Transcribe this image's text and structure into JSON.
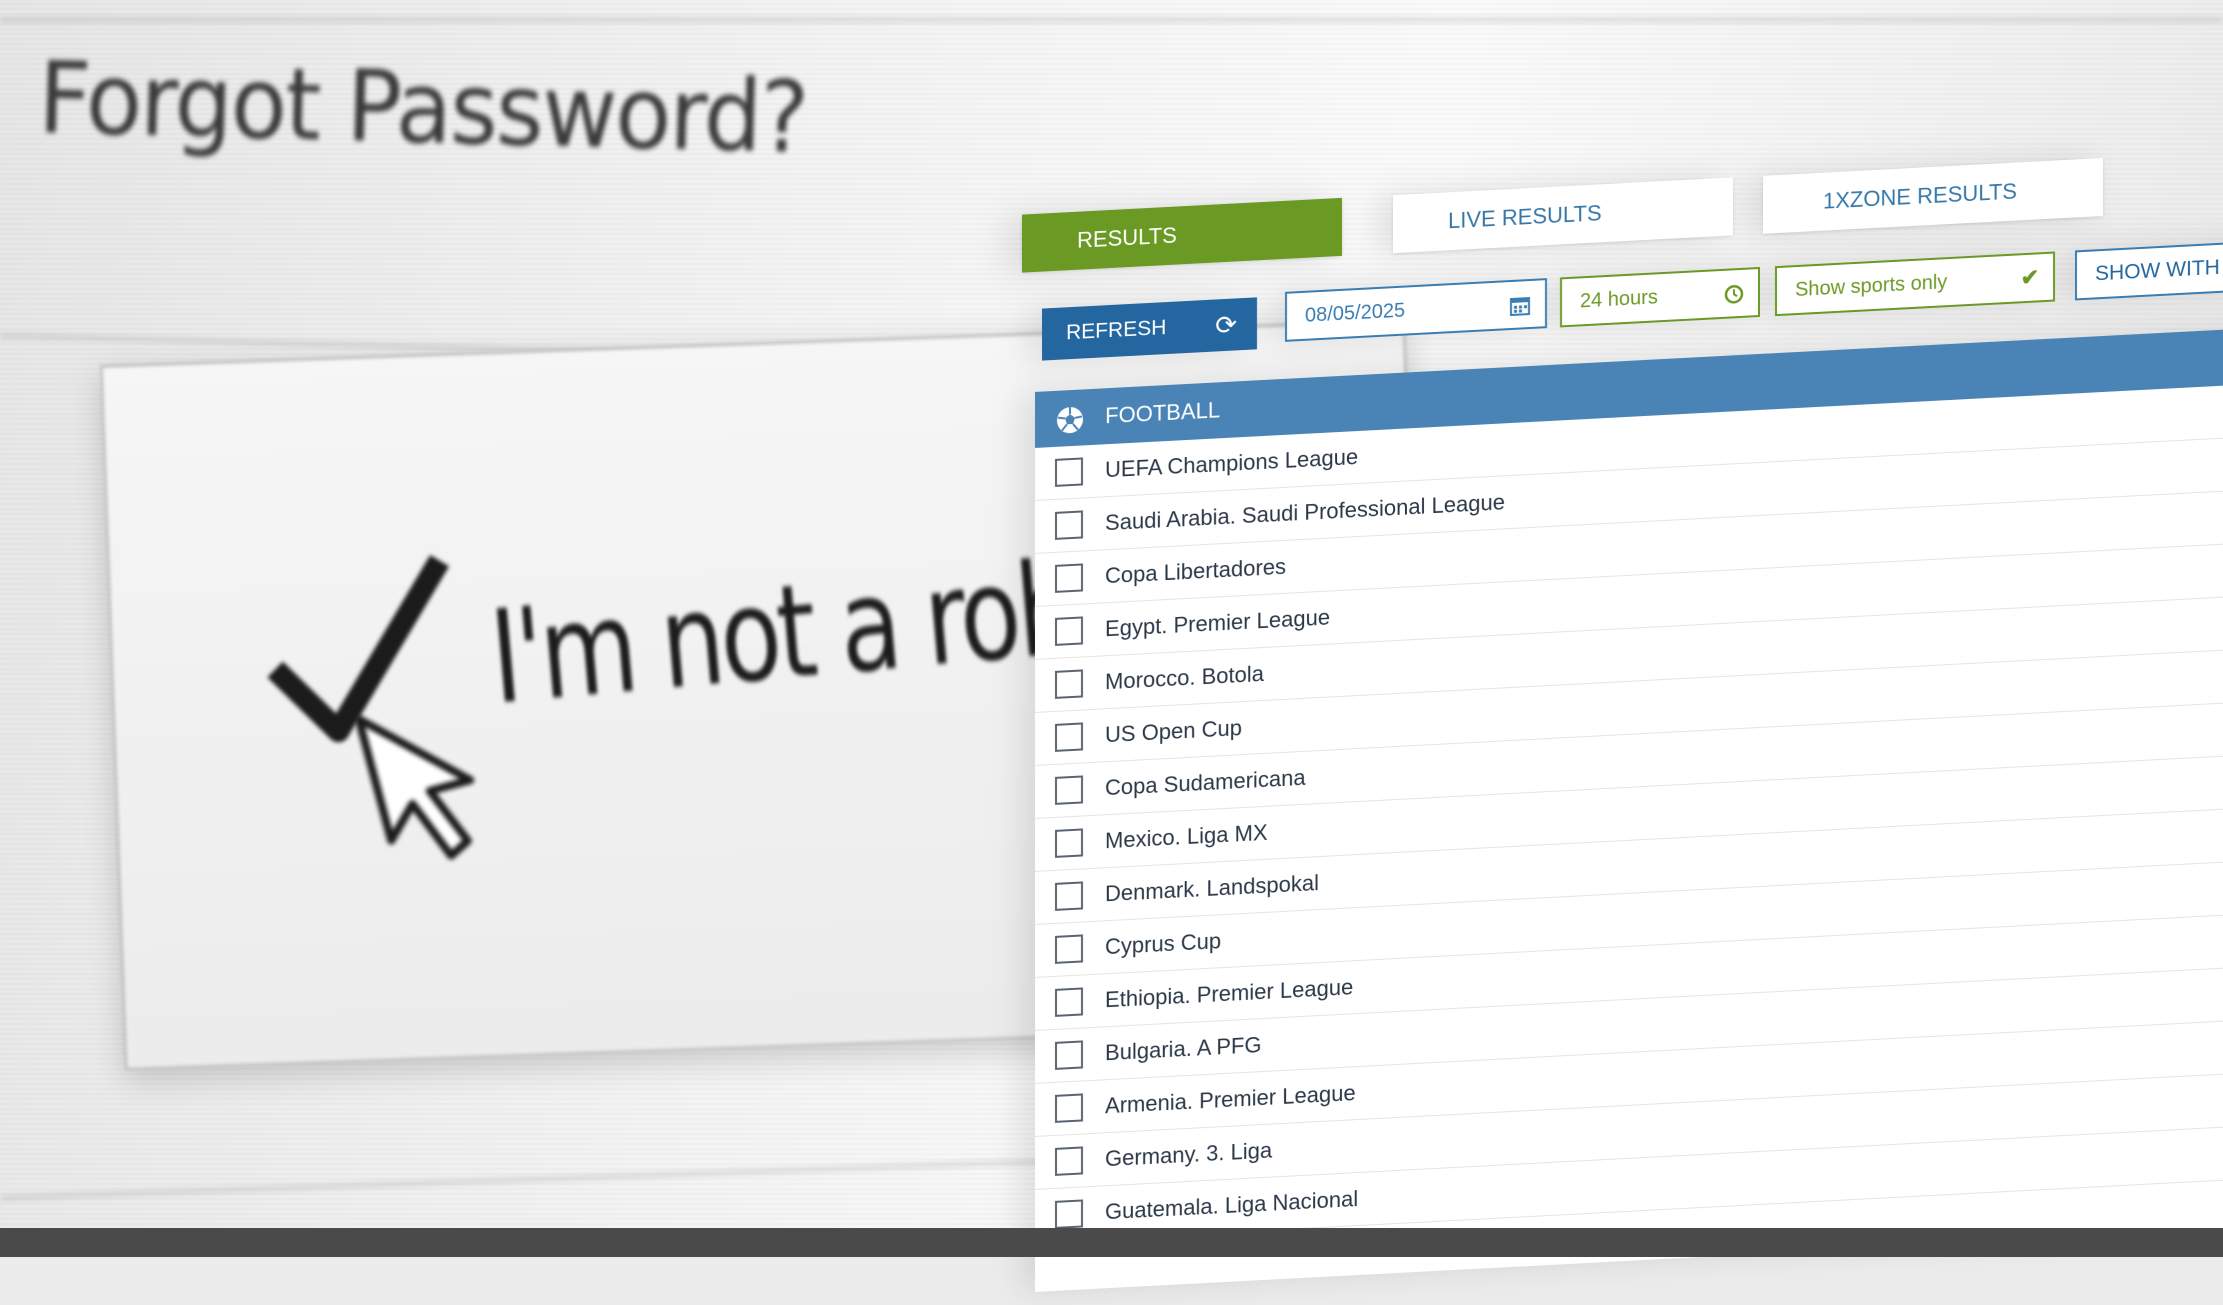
{
  "background": {
    "forgot_password": "Forgot Password?",
    "captcha_label": "I'm not a robot"
  },
  "tabs": [
    {
      "label": "RESULTS",
      "active": true
    },
    {
      "label": "LIVE RESULTS",
      "active": false
    },
    {
      "label": "1XZONE RESULTS",
      "active": false
    }
  ],
  "filters": {
    "refresh_label": "REFRESH",
    "date": "08/05/2025",
    "hours": "24 hours",
    "sports_only": "Show sports only",
    "show_with": "SHOW WITH"
  },
  "sport": {
    "name": "FOOTBALL",
    "icon": "soccer-ball-icon",
    "leagues": [
      "UEFA Champions League",
      "Saudi Arabia. Saudi Professional League",
      "Copa Libertadores",
      "Egypt. Premier League",
      "Morocco. Botola",
      "US Open Cup",
      "Copa Sudamericana",
      "Mexico. Liga MX",
      "Denmark. Landspokal",
      "Cyprus Cup",
      "Ethiopia. Premier League",
      "Bulgaria. A PFG",
      "Armenia. Premier League",
      "Germany. 3. Liga",
      "Guatemala. Liga Nacional"
    ]
  },
  "colors": {
    "accent_green": "#6a9a23",
    "accent_blue": "#24669f",
    "header_blue": "#4a84b7"
  }
}
